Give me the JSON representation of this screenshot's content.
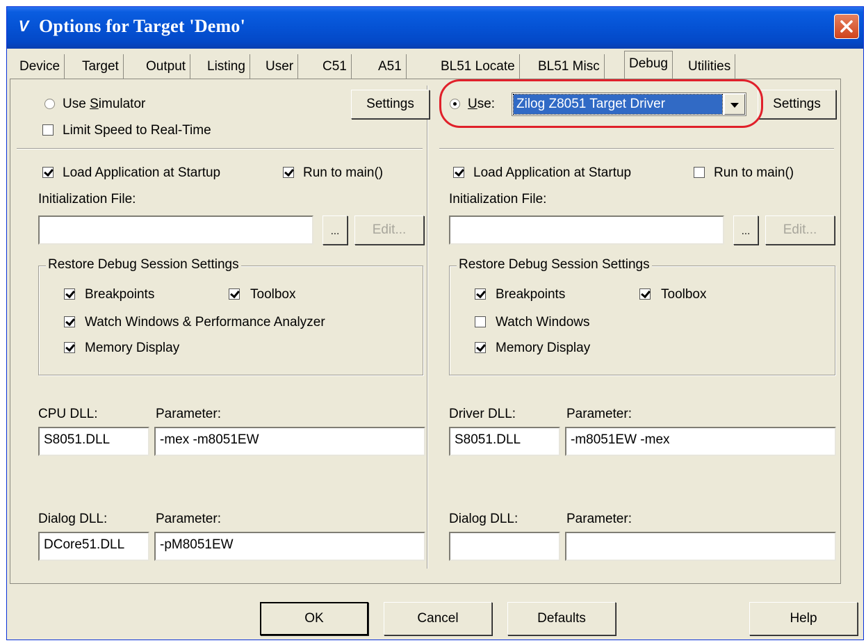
{
  "window": {
    "title": "Options for Target 'Demo'"
  },
  "tabs": [
    {
      "label": "Device"
    },
    {
      "label": "Target"
    },
    {
      "label": "Output"
    },
    {
      "label": "Listing"
    },
    {
      "label": "User"
    },
    {
      "label": "C51"
    },
    {
      "label": "A51"
    },
    {
      "label": "BL51 Locate"
    },
    {
      "label": "BL51 Misc"
    },
    {
      "label": "Debug"
    },
    {
      "label": "Utilities"
    }
  ],
  "left": {
    "use_simulator": "Use Simulator",
    "limit_speed": "Limit Speed to Real-Time",
    "settings": "Settings",
    "load_app": "Load Application at Startup",
    "run_to_main": "Run to main()",
    "init_file_label": "Initialization File:",
    "init_file_value": "",
    "browse": "...",
    "edit": "Edit...",
    "restore_title": "Restore Debug Session Settings",
    "breakpoints": "Breakpoints",
    "toolbox": "Toolbox",
    "watch": "Watch Windows & Performance Analyzer",
    "memory": "Memory Display",
    "cpu_dll_label": "CPU DLL:",
    "cpu_dll_value": "S8051.DLL",
    "cpu_param_label": "Parameter:",
    "cpu_param_value": "-mex -m8051EW",
    "dialog_dll_label": "Dialog DLL:",
    "dialog_dll_value": "DCore51.DLL",
    "dialog_param_label": "Parameter:",
    "dialog_param_value": "-pM8051EW"
  },
  "right": {
    "use": "Use:",
    "driver_selected": "Zilog Z8051 Target Driver",
    "settings": "Settings",
    "load_app": "Load Application at Startup",
    "run_to_main": "Run to main()",
    "init_file_label": "Initialization File:",
    "init_file_value": "",
    "browse": "...",
    "edit": "Edit...",
    "restore_title": "Restore Debug Session Settings",
    "breakpoints": "Breakpoints",
    "toolbox": "Toolbox",
    "watch": "Watch Windows",
    "memory": "Memory Display",
    "driver_dll_label": "Driver DLL:",
    "driver_dll_value": "S8051.DLL",
    "driver_param_label": "Parameter:",
    "driver_param_value": "-m8051EW -mex",
    "dialog_dll_label": "Dialog DLL:",
    "dialog_dll_value": "",
    "dialog_param_label": "Parameter:",
    "dialog_param_value": ""
  },
  "buttons": {
    "ok": "OK",
    "cancel": "Cancel",
    "defaults": "Defaults",
    "help": "Help"
  },
  "colors": {
    "highlight": "#e0202a",
    "titlebar": "#0552d4",
    "selection": "#316ac5"
  }
}
